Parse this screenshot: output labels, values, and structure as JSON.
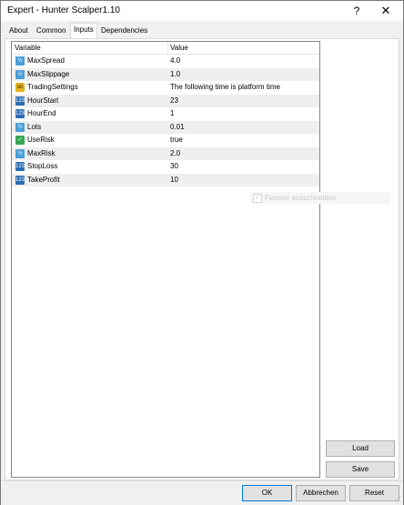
{
  "window": {
    "title": "Expert - Hunter Scalper1.10",
    "help_label": "?",
    "close_label": "✕"
  },
  "tabs": [
    {
      "label": "About",
      "active": false
    },
    {
      "label": "Common",
      "active": false
    },
    {
      "label": "Inputs",
      "active": true
    },
    {
      "label": "Dependencies",
      "active": false
    }
  ],
  "inputs_table": {
    "columns": [
      "Variable",
      "Value"
    ],
    "rows": [
      {
        "variable": "MaxSpread",
        "value": "4.0",
        "icon": "double-type-icon"
      },
      {
        "variable": "MaxSlippage",
        "value": "1.0",
        "icon": "double-type-icon"
      },
      {
        "variable": "TradingSettings",
        "value": "The following time is platform time",
        "icon": "string-type-icon"
      },
      {
        "variable": "HourStart",
        "value": "23",
        "icon": "integer-type-icon"
      },
      {
        "variable": "HourEnd",
        "value": "1",
        "icon": "integer-type-icon"
      },
      {
        "variable": "Lots",
        "value": "0.01",
        "icon": "double-type-icon"
      },
      {
        "variable": "UseRisk",
        "value": "true",
        "icon": "boolean-type-icon"
      },
      {
        "variable": "MaxRisk",
        "value": "2.0",
        "icon": "double-type-icon"
      },
      {
        "variable": "StopLoss",
        "value": "30",
        "icon": "integer-type-icon"
      },
      {
        "variable": "TakeProfit",
        "value": "10",
        "icon": "integer-type-icon"
      }
    ]
  },
  "icon_glyphs": {
    "double": "½",
    "int": "123",
    "bool": "✓",
    "string": "ab"
  },
  "faded_checkbox": {
    "label": "Fenster ausschneiden",
    "mark": "✓"
  },
  "side_buttons": {
    "load": "Load",
    "save": "Save"
  },
  "dialog_buttons": {
    "ok": "OK",
    "cancel": "Abbrechen",
    "reset": "Reset"
  },
  "colors": {
    "primary_button_border": "#0078d7",
    "double_icon": "#4a9fd8",
    "integer_icon": "#2d6db5",
    "boolean_icon": "#3aa655",
    "string_icon": "#e6b422"
  }
}
